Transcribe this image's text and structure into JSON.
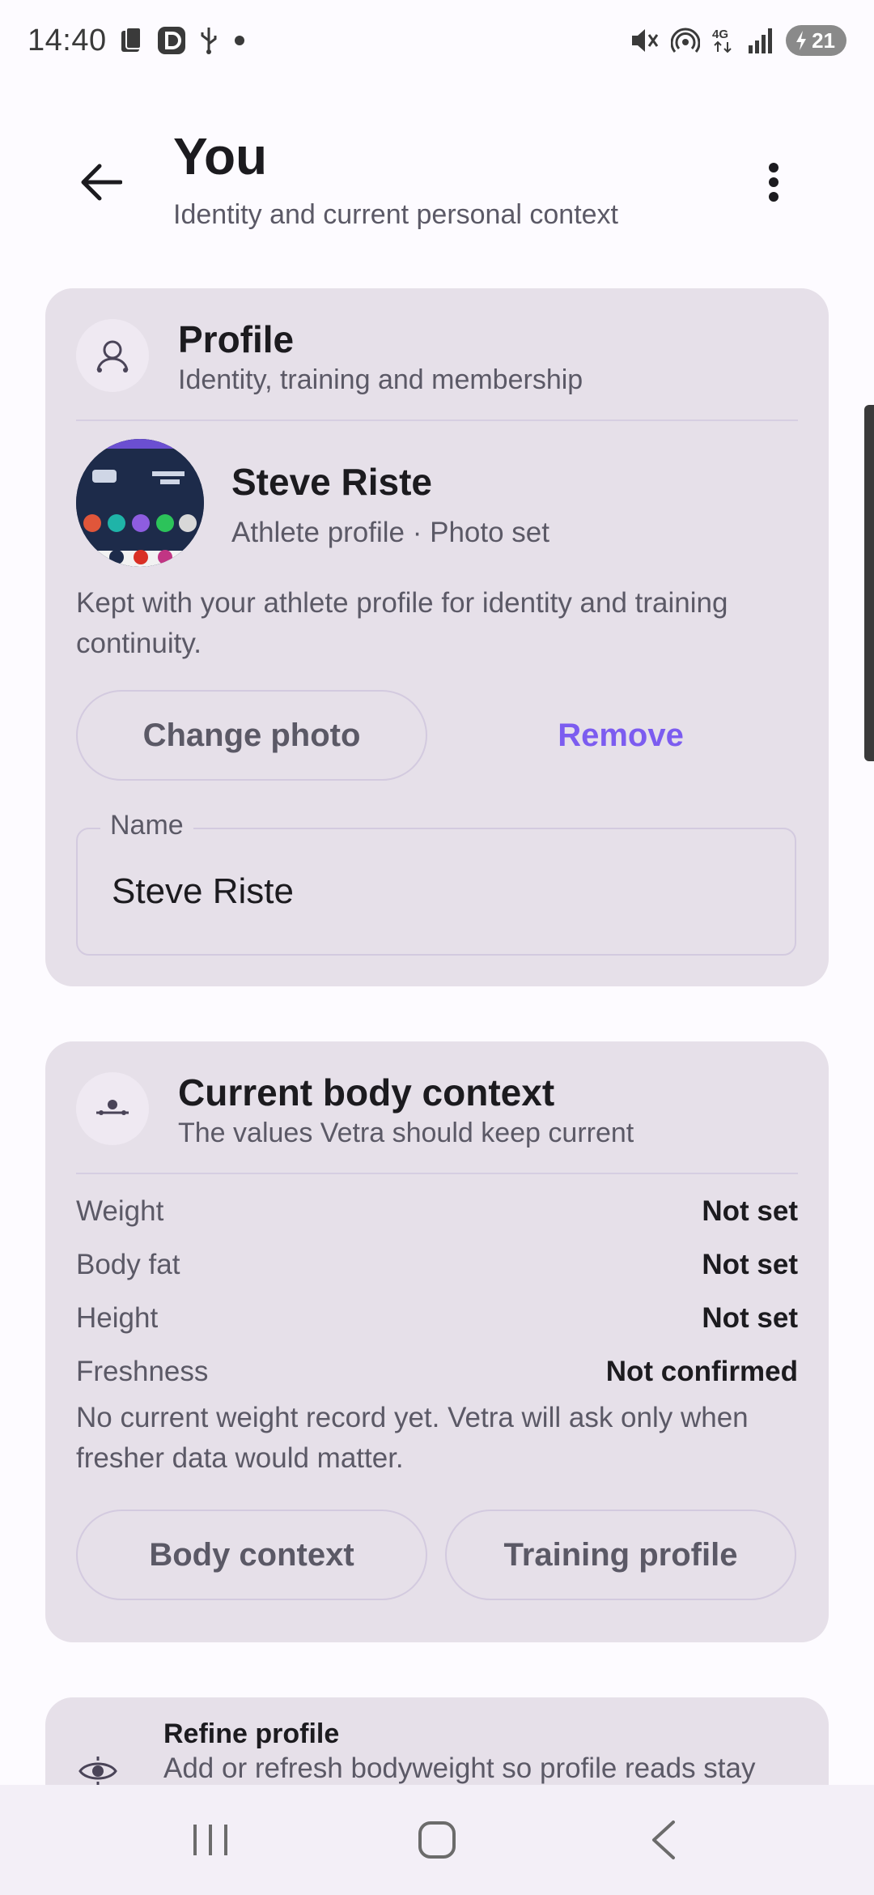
{
  "status_bar": {
    "time": "14:40",
    "battery_level": "21",
    "icons": [
      "clipboard-icon",
      "d-app-icon",
      "usb-icon",
      "dot-icon",
      "mute-icon",
      "hotspot-icon",
      "4g-icon",
      "signal-icon",
      "battery-icon"
    ]
  },
  "header": {
    "title": "You",
    "subtitle": "Identity and current personal context"
  },
  "profile_card": {
    "title": "Profile",
    "subtitle": "Identity, training and membership",
    "name": "Steve Riste",
    "meta": "Athlete profile · Photo set",
    "description": "Kept with your athlete profile for identity and training continuity.",
    "change_photo_label": "Change photo",
    "remove_label": "Remove",
    "name_field": {
      "label": "Name",
      "value": "Steve Riste"
    }
  },
  "body_card": {
    "title": "Current body context",
    "subtitle": "The values Vetra should keep current",
    "rows": [
      {
        "label": "Weight",
        "value": "Not set"
      },
      {
        "label": "Body fat",
        "value": "Not set"
      },
      {
        "label": "Height",
        "value": "Not set"
      },
      {
        "label": "Freshness",
        "value": "Not confirmed"
      }
    ],
    "note": "No current weight record yet. Vetra will ask only when fresher data would matter.",
    "body_context_label": "Body context",
    "training_profile_label": "Training profile"
  },
  "refine_card": {
    "title": "Refine profile",
    "subtitle": "Add or refresh bodyweight so profile reads stay"
  },
  "colors": {
    "accent": "#7c5cf0",
    "card_bg": "#e6e0e9",
    "page_bg": "#fdfbff"
  }
}
